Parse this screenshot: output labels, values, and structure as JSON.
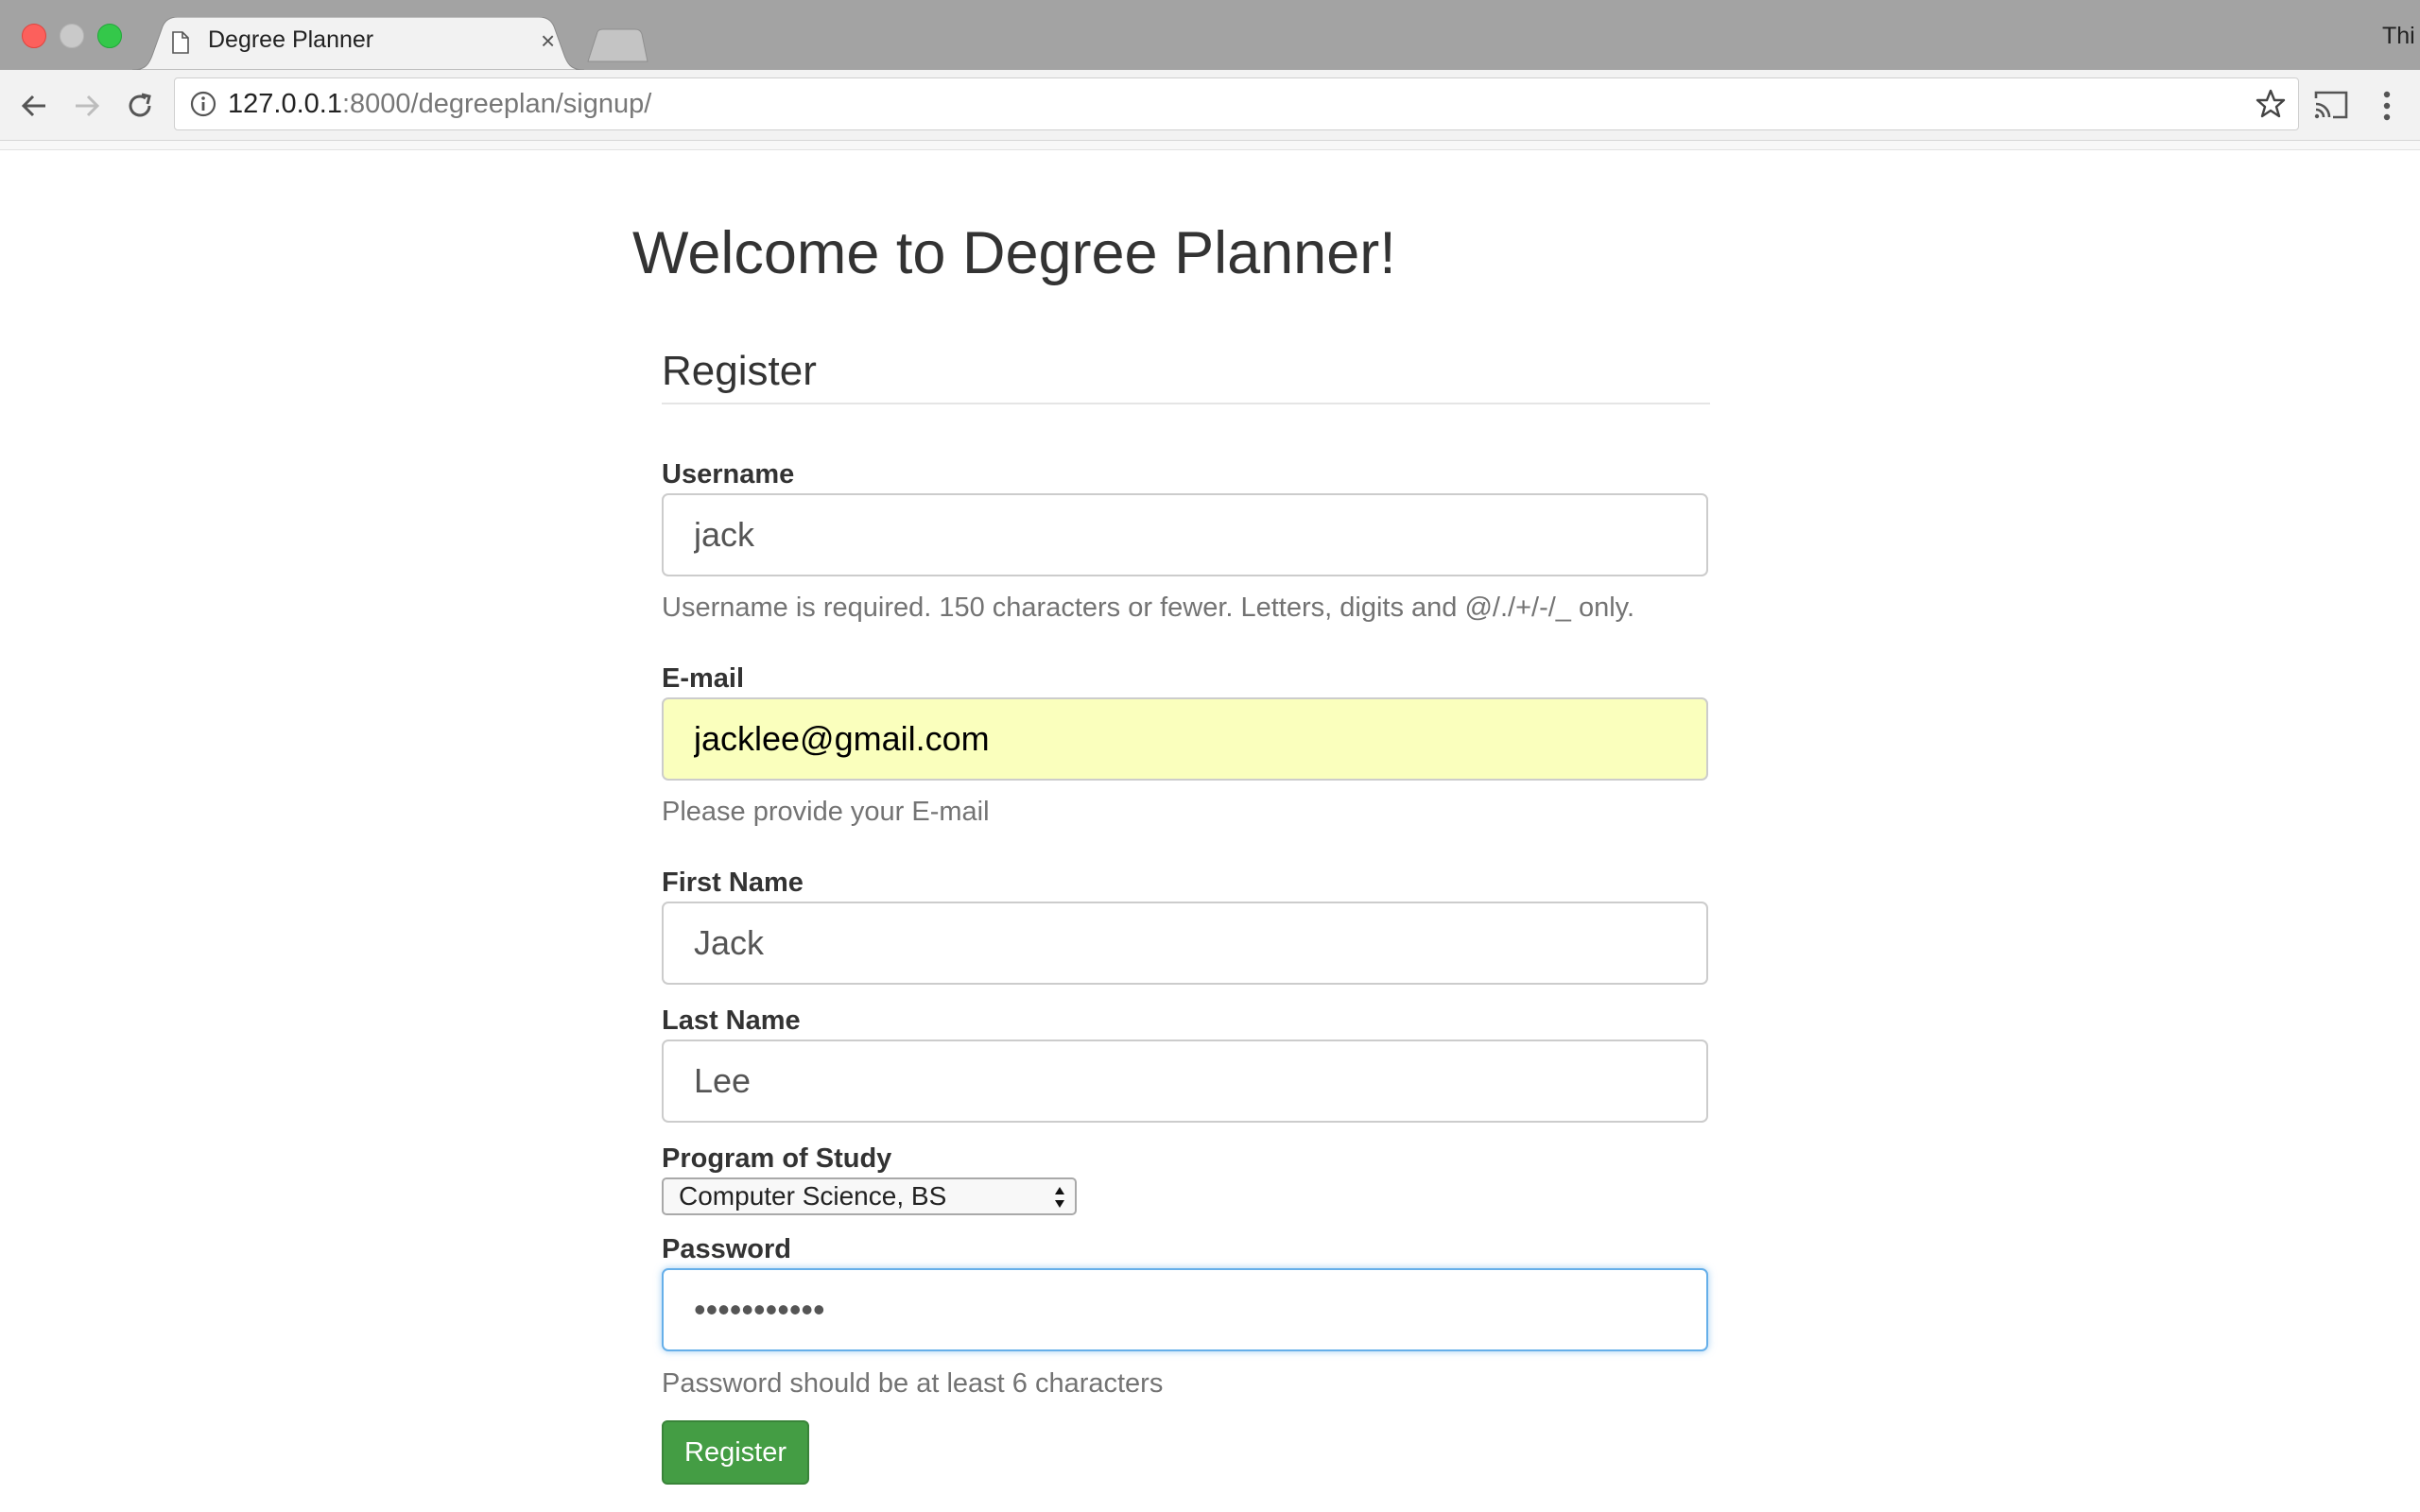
{
  "browser": {
    "tab_title": "Degree Planner",
    "tab_close": "×",
    "profile_name": "Thi",
    "url_host": "127.0.0.1",
    "url_path": ":8000/degreeplan/signup/"
  },
  "page": {
    "heading": "Welcome to Degree Planner!",
    "form_legend": "Register",
    "username": {
      "label": "Username",
      "value": "jack",
      "help": "Username is required. 150 characters or fewer. Letters, digits and @/./+/-/_ only."
    },
    "email": {
      "label": "E-mail",
      "value": "jacklee@gmail.com",
      "help": "Please provide your E-mail"
    },
    "first_name": {
      "label": "First Name",
      "value": "Jack"
    },
    "last_name": {
      "label": "Last Name",
      "value": "Lee"
    },
    "program": {
      "label": "Program of Study",
      "selected": "Computer Science, BS"
    },
    "password": {
      "label": "Password",
      "value": "•••••••••••",
      "help": "Password should be at least 6 characters"
    },
    "submit_label": "Register"
  },
  "colors": {
    "autofill_bg": "#faffbd",
    "button_green": "#449d44",
    "focus_blue": "#66afe9"
  }
}
